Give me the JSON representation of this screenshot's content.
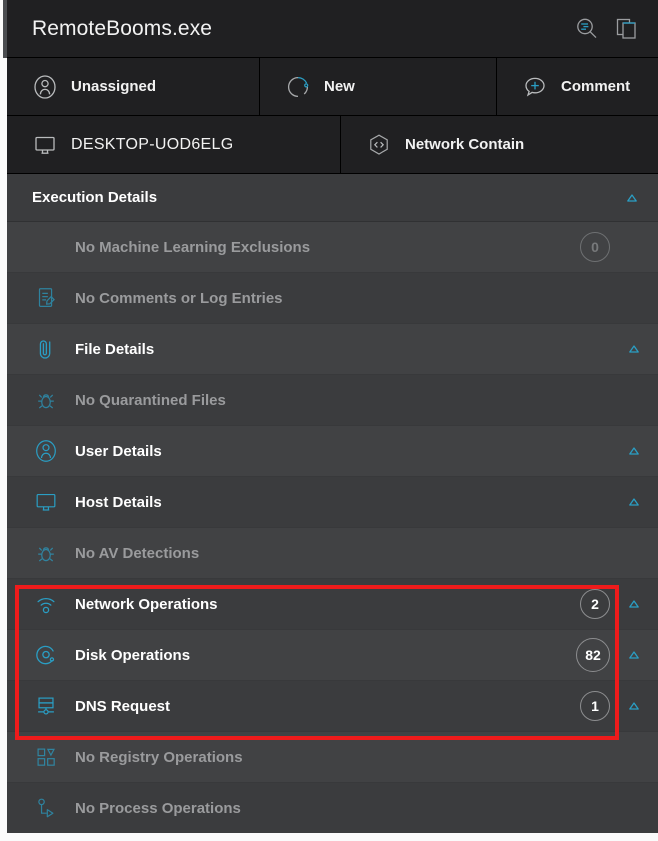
{
  "window": {
    "title": "RemoteBooms.exe",
    "actions": [
      {
        "name": "search-events-icon",
        "label": "Search Events"
      },
      {
        "name": "copy-icon",
        "label": "Copy"
      }
    ]
  },
  "status_tabs": [
    {
      "icon": "user-circle-icon",
      "label": "Unassigned"
    },
    {
      "icon": "status-circle-icon",
      "label": "New"
    },
    {
      "icon": "comment-plus-icon",
      "label": "Comment"
    }
  ],
  "context_tabs": [
    {
      "icon": "monitor-icon",
      "label": "DESKTOP-UOD6ELG",
      "bold": false
    },
    {
      "icon": "hexagon-code-icon",
      "label": "Network Contain",
      "bold": true
    }
  ],
  "section": {
    "title": "Execution Details",
    "chevron": "triangle-up-icon"
  },
  "rows": [
    {
      "icon": "",
      "label": "No Machine Learning Exclusions",
      "badge": "0",
      "muted": true,
      "chevron": false
    },
    {
      "icon": "note-edit-icon",
      "label": "No Comments or Log Entries",
      "badge": "",
      "muted": true,
      "chevron": false
    },
    {
      "icon": "paperclip-icon",
      "label": "File Details",
      "badge": "",
      "muted": false,
      "chevron": true
    },
    {
      "icon": "bug-icon",
      "label": "No Quarantined Files",
      "badge": "",
      "muted": true,
      "chevron": false
    },
    {
      "icon": "user-circle-icon",
      "label": "User Details",
      "badge": "",
      "muted": false,
      "chevron": true
    },
    {
      "icon": "monitor-icon",
      "label": "Host Details",
      "badge": "",
      "muted": false,
      "chevron": true
    },
    {
      "icon": "bug-icon",
      "label": "No AV Detections",
      "badge": "",
      "muted": true,
      "chevron": false
    },
    {
      "icon": "wifi-icon",
      "label": "Network Operations",
      "badge": "2",
      "muted": false,
      "chevron": true
    },
    {
      "icon": "disk-icon",
      "label": "Disk Operations",
      "badge": "82",
      "muted": false,
      "chevron": true
    },
    {
      "icon": "dns-icon",
      "label": "DNS Request",
      "badge": "1",
      "muted": false,
      "chevron": true
    },
    {
      "icon": "registry-icon",
      "label": "No Registry Operations",
      "badge": "",
      "muted": true,
      "chevron": false
    },
    {
      "icon": "process-icon",
      "label": "No Process Operations",
      "badge": "",
      "muted": true,
      "chevron": false
    }
  ],
  "colors": {
    "accent": "#2a9ec4",
    "highlight": "#ef1b1b",
    "panel_bg": "#2a2a2c",
    "row_bg": "#414244",
    "row_alt_bg": "#3b3c3e",
    "text": "#ffffff",
    "muted_text": "#9a9b9d"
  }
}
